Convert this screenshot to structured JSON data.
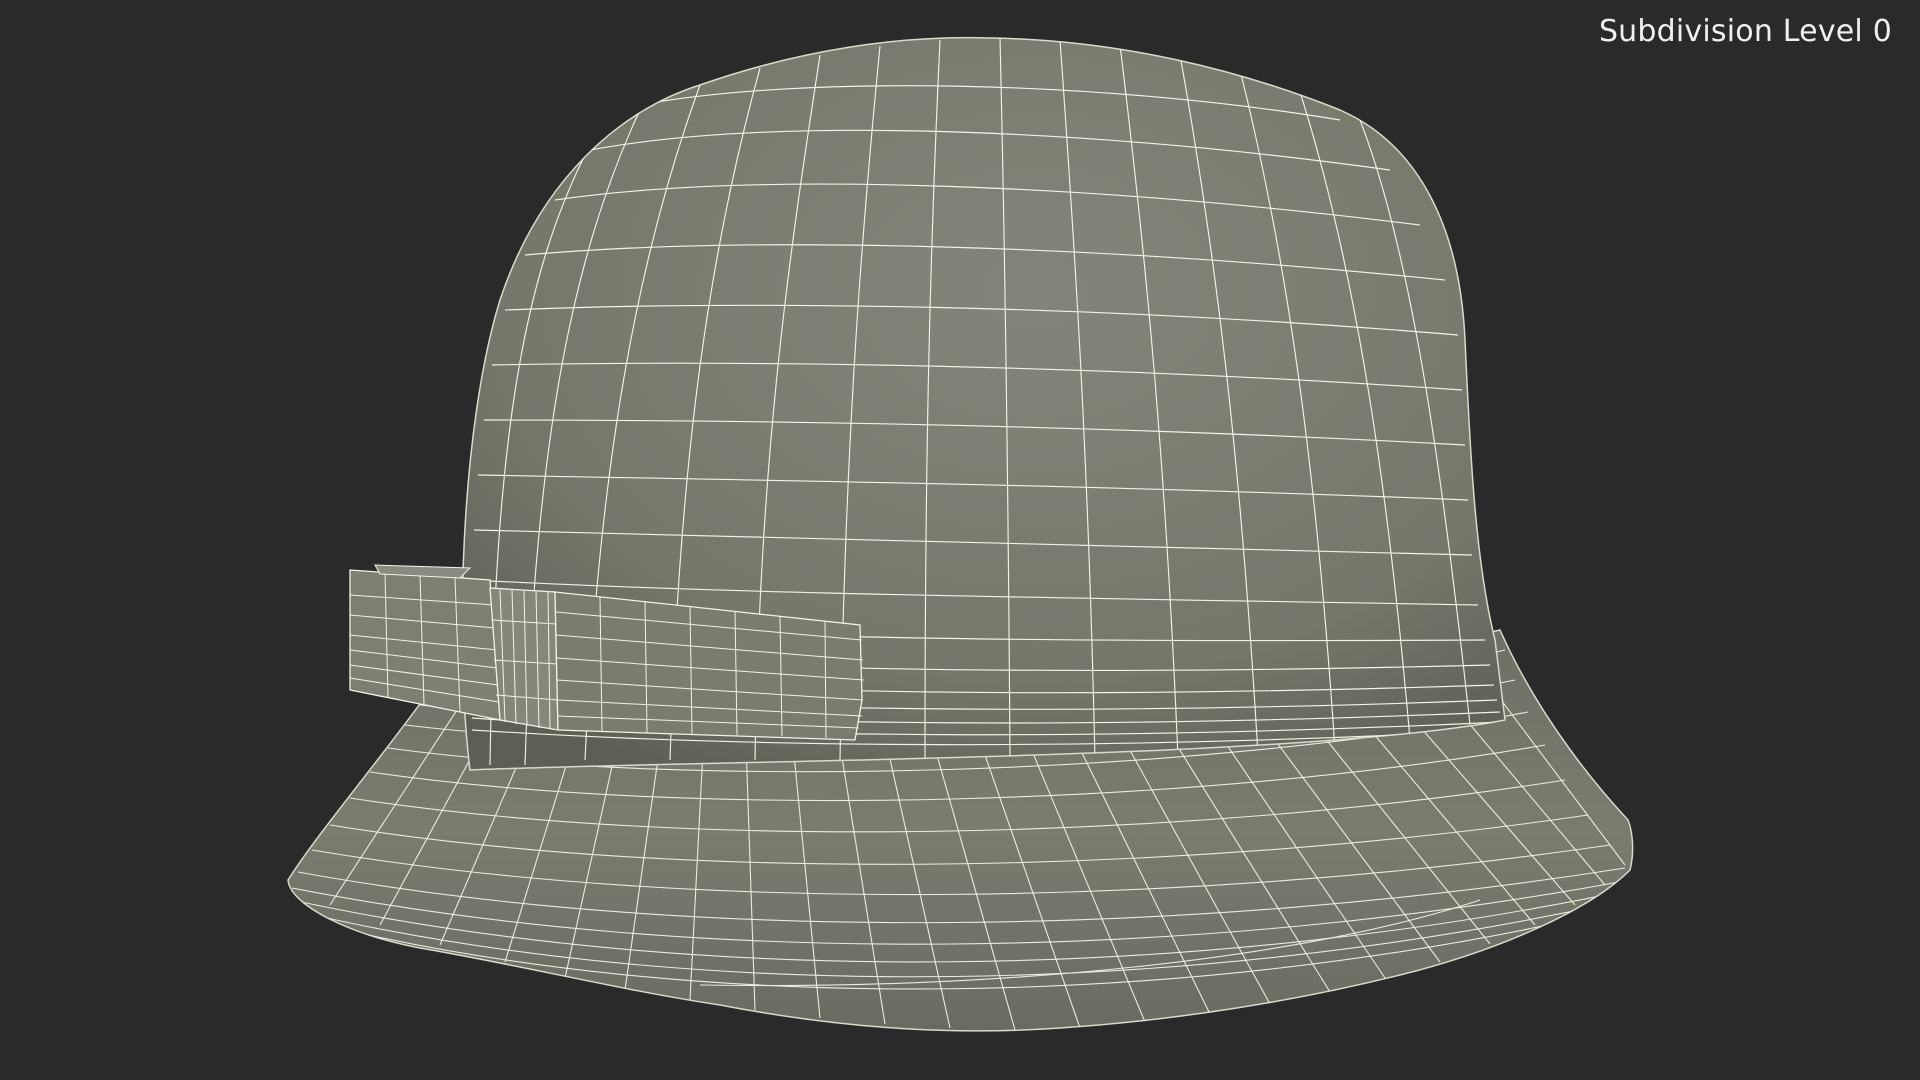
{
  "viewport": {
    "subdivision_label": "Subdivision Level 0"
  },
  "colors": {
    "background": "#2a2a2a",
    "mesh_surface": "#7a7a6e",
    "wireframe": "#f2f2e6"
  }
}
